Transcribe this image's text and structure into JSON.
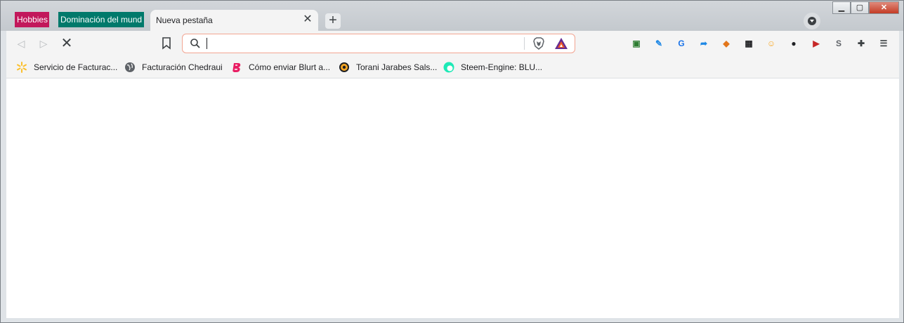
{
  "tabs": {
    "groups": [
      {
        "label": "Hobbies",
        "color": "#c2185b"
      },
      {
        "label": "Dominación del mund",
        "color": "#00796b"
      }
    ],
    "active": {
      "title": "Nueva pestaña"
    },
    "new_tab_symbol": "+",
    "close_symbol": "✕"
  },
  "window_controls": {
    "minimize": "▁",
    "maximize": "▢",
    "close": "✕"
  },
  "toolbar": {
    "back_symbol": "◁",
    "forward_symbol": "▷",
    "stop_symbol": "✕",
    "omnibox": {
      "value": "",
      "placeholder": ""
    },
    "extensions": [
      {
        "name": "ext-qrcolor-icon",
        "glyph": "▣",
        "color": "#2e7d32"
      },
      {
        "name": "ext-wand-icon",
        "glyph": "✎",
        "color": "#1e88e5"
      },
      {
        "name": "ext-translate-icon",
        "glyph": "G",
        "color": "#1a73e8"
      },
      {
        "name": "ext-share-icon",
        "glyph": "➦",
        "color": "#1e88e5"
      },
      {
        "name": "ext-metamask-icon",
        "glyph": "◆",
        "color": "#e2761b"
      },
      {
        "name": "ext-qr-icon",
        "glyph": "▦",
        "color": "#202124"
      },
      {
        "name": "ext-emoji-icon",
        "glyph": "☺",
        "color": "#f9a825"
      },
      {
        "name": "ext-darkmode-icon",
        "glyph": "●",
        "color": "#202124"
      },
      {
        "name": "ext-speed-icon",
        "glyph": "▶",
        "color": "#c62828"
      },
      {
        "name": "ext-s-icon",
        "glyph": "S",
        "color": "#5f6368"
      },
      {
        "name": "extensions-puzzle-icon",
        "glyph": "✚",
        "color": "#3c4043"
      },
      {
        "name": "menu-icon",
        "glyph": "☰",
        "color": "#3c4043"
      }
    ]
  },
  "bookmarks": [
    {
      "label": "Servicio de Facturac...",
      "icon_color": "#fbc02d"
    },
    {
      "label": "Facturación Chedraui",
      "icon_color": "#5f6368"
    },
    {
      "label": "Cómo enviar Blurt a...",
      "icon_color": "#e91e63"
    },
    {
      "label": "Torani Jarabes Sals...",
      "icon_color": "#f9a825"
    },
    {
      "label": "Steem-Engine: BLU...",
      "icon_color": "#1de9b6"
    }
  ]
}
